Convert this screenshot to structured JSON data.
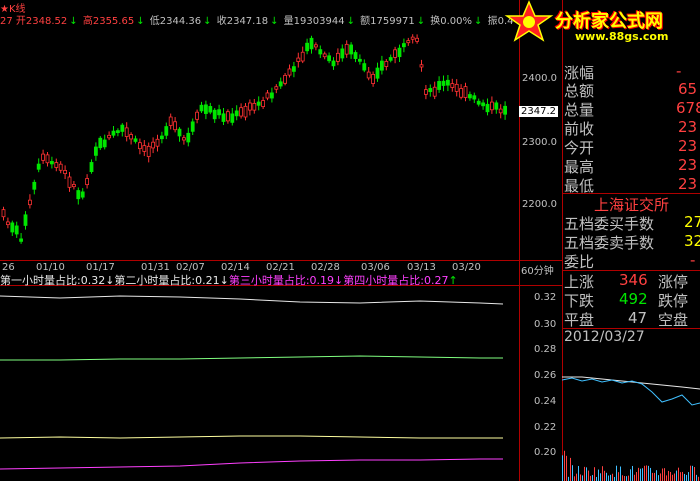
{
  "title": "★K线",
  "infobar": {
    "open": "27 开2348.52",
    "high": "高2355.65",
    "low": "低2344.36",
    "close": "收2347.18",
    "volume": "量19303944",
    "amount": "额1759971",
    "turnover": "换0.00%",
    "amplitude": "振0.4"
  },
  "logo": {
    "text": "分析家公式网",
    "url": "www.88gs.com"
  },
  "price_axis": [
    "2400.0",
    "2300.0",
    "2200.0"
  ],
  "current_price": "2347.2",
  "date_axis": [
    "26",
    "01/10",
    "01/17",
    "01/31",
    "02/07",
    "02/14",
    "02/21",
    "02/28",
    "03/06",
    "03/13",
    "03/20"
  ],
  "period": "60分钟",
  "indicator": {
    "l1": "第一小时量占比:0.32",
    "l2": "第二小时量占比:0.21",
    "l3": "第三小时量占比:0.19",
    "l4": "第四小时量占比:0.27",
    "axis": [
      "0.32",
      "0.30",
      "0.28",
      "0.26",
      "0.24",
      "0.22",
      "0.20"
    ]
  },
  "quote": {
    "rows": [
      {
        "label": "涨幅",
        "value": "-"
      },
      {
        "label": "总额",
        "value": "65"
      },
      {
        "label": "总量",
        "value": "678"
      },
      {
        "label": "前收",
        "value": "23"
      },
      {
        "label": "今开",
        "value": "23"
      },
      {
        "label": "最高",
        "value": "23"
      },
      {
        "label": "最低",
        "value": "23"
      }
    ],
    "exchange": "上海证交所",
    "buy_label": "五档委买手数",
    "buy_value": "27",
    "sell_label": "五档委卖手数",
    "sell_value": "32",
    "ratio_label": "委比",
    "ratio_value": "-",
    "up": "上涨",
    "up_count": "346",
    "limit_up": "涨停",
    "down": "下跌",
    "down_count": "492",
    "limit_down": "跌停",
    "flat": "平盘",
    "flat_count": "47",
    "suspended": "空盘",
    "date": "2012/03/27"
  },
  "colors": {
    "up": "#ff3232",
    "down": "#00e600",
    "bg": "#000000",
    "grid": "#b00000"
  }
}
